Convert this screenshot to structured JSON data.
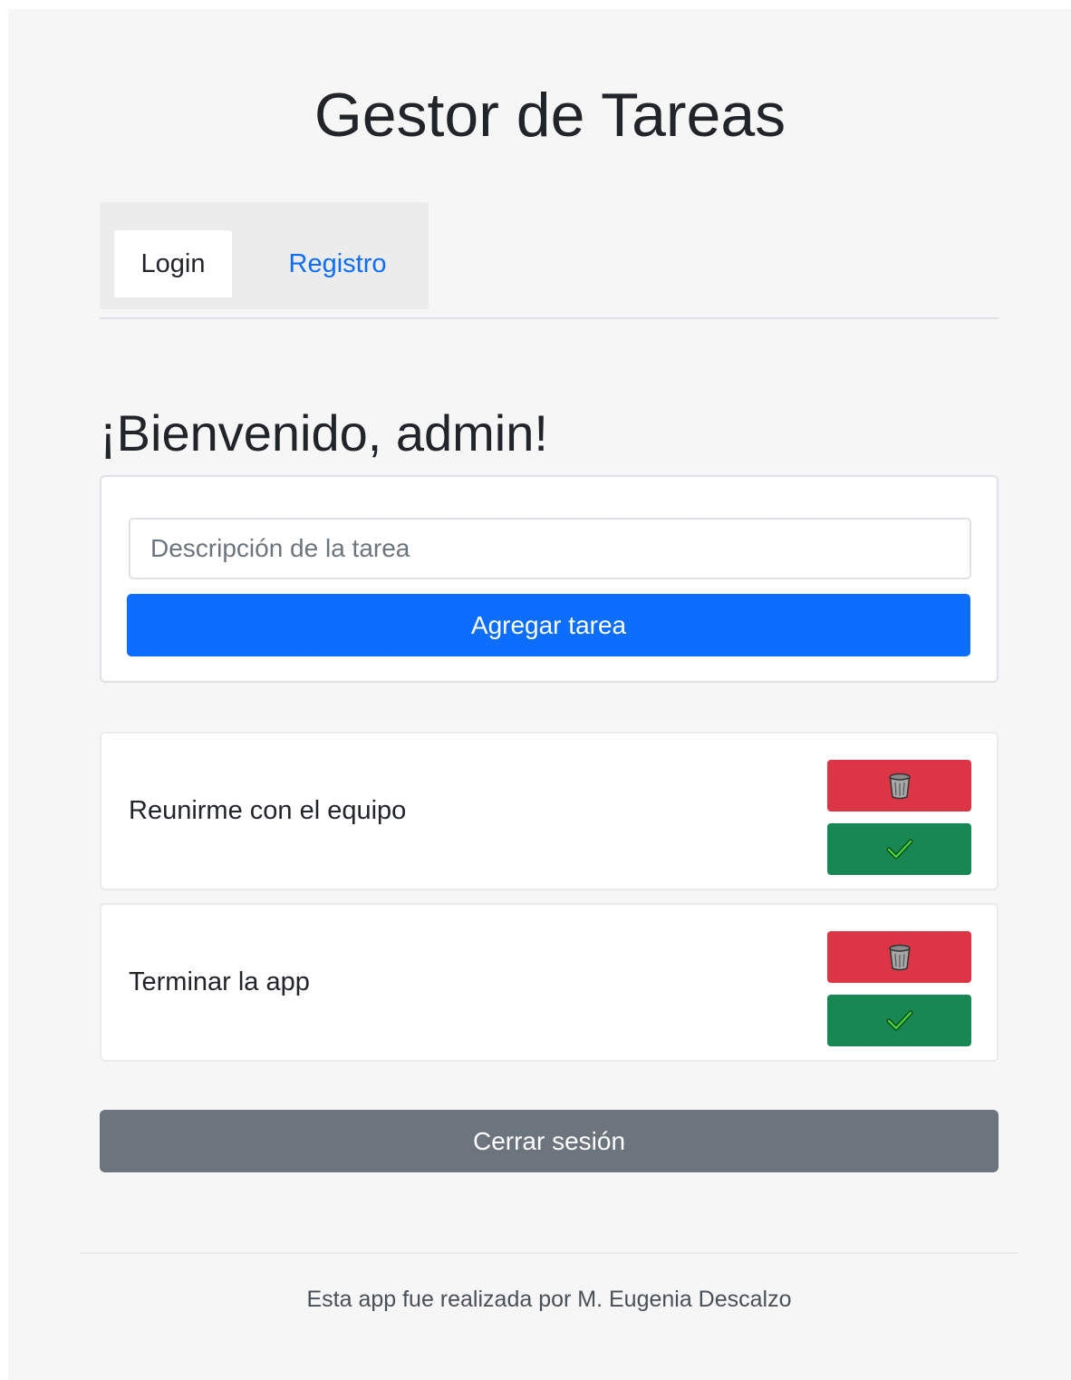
{
  "header": {
    "title": "Gestor de Tareas"
  },
  "tabs": [
    {
      "label": "Login",
      "active": true
    },
    {
      "label": "Registro",
      "active": false
    }
  ],
  "welcome": "¡Bienvenido, admin!",
  "task_form": {
    "placeholder": "Descripción de la tarea",
    "value": "",
    "add_label": "Agregar tarea"
  },
  "tasks": [
    {
      "text": "Reunirme con el equipo",
      "delete_icon": "trash-icon",
      "done_icon": "check-icon"
    },
    {
      "text": "Terminar la app",
      "delete_icon": "trash-icon",
      "done_icon": "check-icon"
    }
  ],
  "logout_label": "Cerrar sesión",
  "footer": {
    "text": "Esta app fue realizada por M. Eugenia Descalzo"
  },
  "colors": {
    "primary": "#0d6efd",
    "danger": "#dc3545",
    "success": "#198754",
    "secondary": "#6c757d"
  }
}
